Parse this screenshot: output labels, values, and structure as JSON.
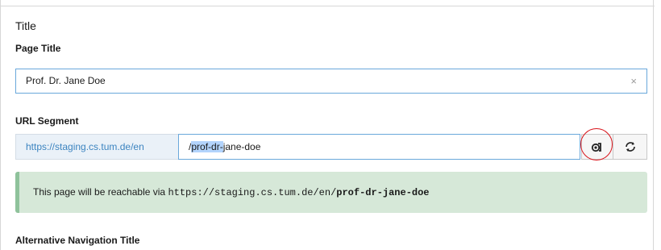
{
  "section": {
    "title": "Title"
  },
  "page_title": {
    "label": "Page Title",
    "value": "Prof. Dr. Jane Doe",
    "clear_icon": "×"
  },
  "url_segment": {
    "label": "URL Segment",
    "prefix": "https://staging.cs.tum.de/en",
    "value_slash": "/",
    "value_selected": "prof-dr-",
    "value_rest": "jane-doe",
    "link_button_icon": "link-toggle-icon",
    "refresh_button_icon": "refresh-icon",
    "notice": {
      "text": "This page will be reachable via ",
      "url_base": "https://staging.cs.tum.de/en/",
      "url_slug": "prof-dr-jane-doe"
    }
  },
  "alt_nav": {
    "label": "Alternative Navigation Title"
  },
  "colors": {
    "input_border": "#6aa8db",
    "prefix_text": "#3c84c0",
    "notice_bg": "#d6e8d8",
    "highlight_circle": "#d9141b"
  }
}
